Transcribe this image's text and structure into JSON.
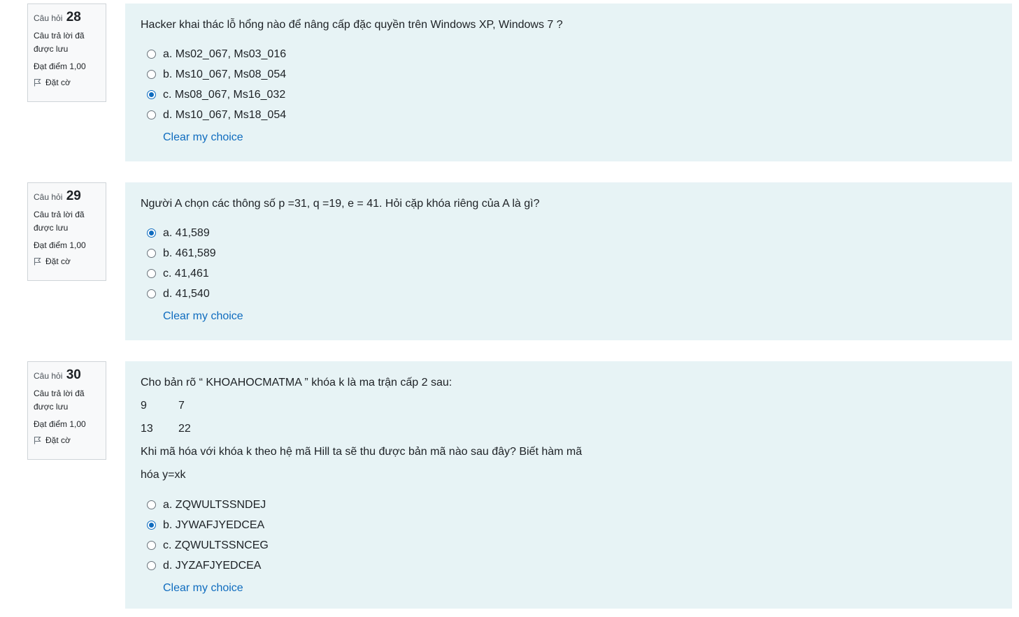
{
  "questions": [
    {
      "label": "Câu hỏi",
      "number": "28",
      "state": "Câu trả lời đã được lưu",
      "grade": "Đạt điểm 1,00",
      "flag": "Đặt cờ",
      "text": "Hacker khai thác lỗ hổng nào để nâng cấp đặc quyền trên Windows XP, Windows 7 ?",
      "options": [
        {
          "label": "a. Ms02_067, Ms03_016",
          "checked": false
        },
        {
          "label": "b. Ms10_067, Ms08_054",
          "checked": false
        },
        {
          "label": "c. Ms08_067, Ms16_032",
          "checked": true
        },
        {
          "label": "d. Ms10_067, Ms18_054",
          "checked": false
        }
      ],
      "clear": "Clear my choice"
    },
    {
      "label": "Câu hỏi",
      "number": "29",
      "state": "Câu trả lời đã được lưu",
      "grade": "Đạt điểm 1,00",
      "flag": "Đặt cờ",
      "text": "Người A chọn các thông số p =31, q =19, e = 41. Hỏi cặp khóa riêng của A là gì?",
      "options": [
        {
          "label": "a. 41,589",
          "checked": true
        },
        {
          "label": "b. 461,589",
          "checked": false
        },
        {
          "label": "c. 41,461",
          "checked": false
        },
        {
          "label": "d. 41,540",
          "checked": false
        }
      ],
      "clear": "Clear my choice"
    },
    {
      "label": "Câu hỏi",
      "number": "30",
      "state": "Câu trả lời đã được lưu",
      "grade": "Đạt điểm 1,00",
      "flag": "Đặt cờ",
      "text": "Cho bản rõ “ KHOAHOCMATMA ” khóa k là ma trận cấp 2 sau:",
      "matrix": [
        [
          "9",
          "7"
        ],
        [
          "13",
          "22"
        ]
      ],
      "text2": "Khi mã hóa với khóa k theo hệ mã Hill ta sẽ thu được bản mã nào sau đây? Biết hàm mã",
      "text3": "hóa y=xk",
      "options": [
        {
          "label": "a. ZQWULTSSNDEJ",
          "checked": false
        },
        {
          "label": "b. JYWAFJYEDCEA",
          "checked": true
        },
        {
          "label": "c. ZQWULTSSNCEG",
          "checked": false
        },
        {
          "label": "d. JYZAFJYEDCEA",
          "checked": false
        }
      ],
      "clear": "Clear my choice"
    }
  ],
  "colors": {
    "accent": "#0f6cbf",
    "panel_bg": "#e7f3f5",
    "info_bg": "#f8f9fa"
  },
  "icons": {
    "flag": "flag-icon"
  }
}
